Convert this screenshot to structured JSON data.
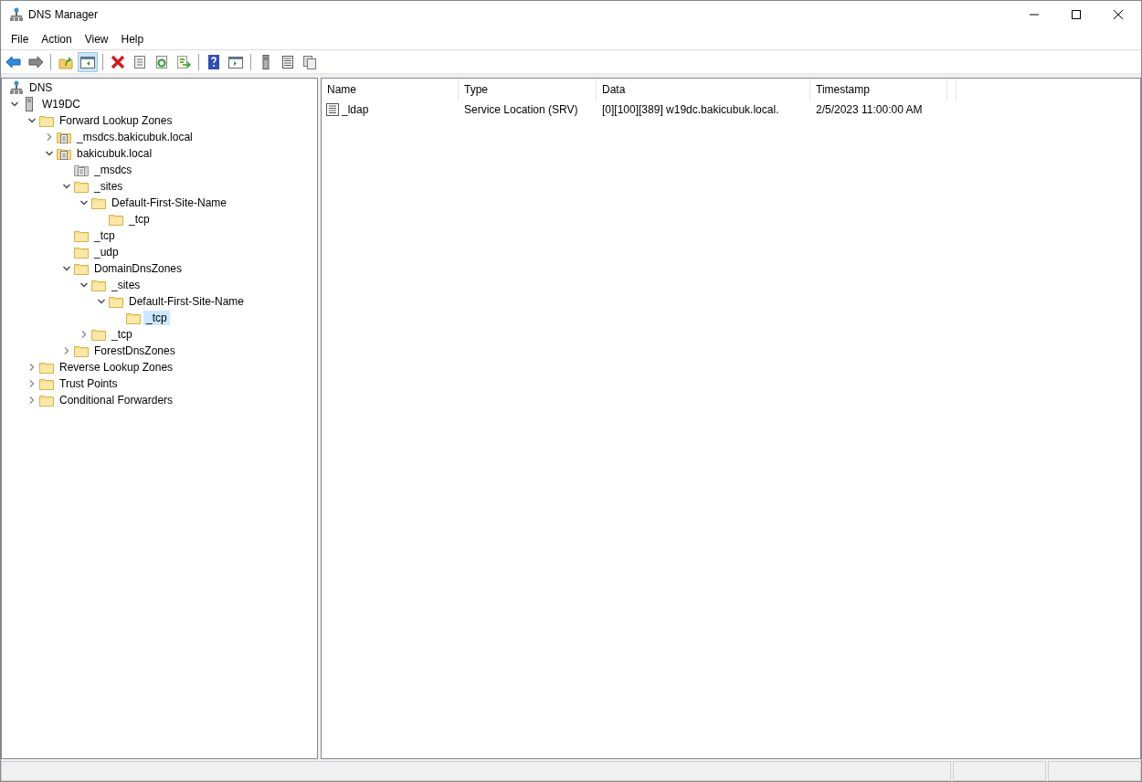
{
  "window": {
    "title": "DNS Manager"
  },
  "menu": [
    "File",
    "Action",
    "View",
    "Help"
  ],
  "toolbar": [
    {
      "kind": "back",
      "pressed": false
    },
    {
      "kind": "forward",
      "pressed": false
    },
    {
      "kind": "sep"
    },
    {
      "kind": "up",
      "pressed": false
    },
    {
      "kind": "tree",
      "pressed": true
    },
    {
      "kind": "sep"
    },
    {
      "kind": "delete",
      "pressed": false
    },
    {
      "kind": "properties",
      "pressed": false
    },
    {
      "kind": "refresh",
      "pressed": false
    },
    {
      "kind": "export",
      "pressed": false
    },
    {
      "kind": "sep"
    },
    {
      "kind": "help",
      "pressed": false
    },
    {
      "kind": "pane",
      "pressed": false
    },
    {
      "kind": "sep"
    },
    {
      "kind": "server",
      "pressed": false
    },
    {
      "kind": "list",
      "pressed": false
    },
    {
      "kind": "copy",
      "pressed": false
    }
  ],
  "tree": [
    {
      "label": "DNS",
      "kind": "network",
      "selected": false,
      "children": [
        {
          "label": "W19DC",
          "kind": "server",
          "expanded": true,
          "selected": false,
          "children": [
            {
              "label": "Forward Lookup Zones",
              "kind": "folder",
              "expanded": true,
              "selected": false,
              "children": [
                {
                  "label": "_msdcs.bakicubuk.local",
                  "kind": "zone",
                  "expanded": false,
                  "selected": false
                },
                {
                  "label": "bakicubuk.local",
                  "kind": "zone",
                  "expanded": true,
                  "selected": false,
                  "children": [
                    {
                      "label": "_msdcs",
                      "kind": "delegation",
                      "selected": false
                    },
                    {
                      "label": "_sites",
                      "kind": "folder",
                      "expanded": true,
                      "selected": false,
                      "children": [
                        {
                          "label": "Default-First-Site-Name",
                          "kind": "folder",
                          "expanded": true,
                          "selected": false,
                          "children": [
                            {
                              "label": "_tcp",
                              "kind": "folder",
                              "selected": false
                            }
                          ]
                        }
                      ]
                    },
                    {
                      "label": "_tcp",
                      "kind": "folder",
                      "selected": false
                    },
                    {
                      "label": "_udp",
                      "kind": "folder",
                      "selected": false
                    },
                    {
                      "label": "DomainDnsZones",
                      "kind": "folder",
                      "expanded": true,
                      "selected": false,
                      "children": [
                        {
                          "label": "_sites",
                          "kind": "folder",
                          "expanded": true,
                          "selected": false,
                          "children": [
                            {
                              "label": "Default-First-Site-Name",
                              "kind": "folder",
                              "expanded": true,
                              "selected": false,
                              "children": [
                                {
                                  "label": "_tcp",
                                  "kind": "folder",
                                  "selected": true
                                }
                              ]
                            }
                          ]
                        },
                        {
                          "label": "_tcp",
                          "kind": "folder",
                          "expanded": false,
                          "selected": false
                        }
                      ]
                    },
                    {
                      "label": "ForestDnsZones",
                      "kind": "folder",
                      "expanded": false,
                      "selected": false
                    }
                  ]
                }
              ]
            },
            {
              "label": "Reverse Lookup Zones",
              "kind": "folder",
              "expanded": false,
              "selected": false
            },
            {
              "label": "Trust Points",
              "kind": "folder",
              "expanded": false,
              "selected": false
            },
            {
              "label": "Conditional Forwarders",
              "kind": "folder",
              "expanded": false,
              "selected": false
            }
          ]
        }
      ]
    }
  ],
  "table": {
    "columns": [
      "Name",
      "Type",
      "Data",
      "Timestamp"
    ],
    "rows": [
      {
        "name": "_ldap",
        "type": "Service Location (SRV)",
        "data": "[0][100][389] w19dc.bakicubuk.local.",
        "timestamp": "2/5/2023 11:00:00 AM",
        "selected": false
      }
    ]
  }
}
